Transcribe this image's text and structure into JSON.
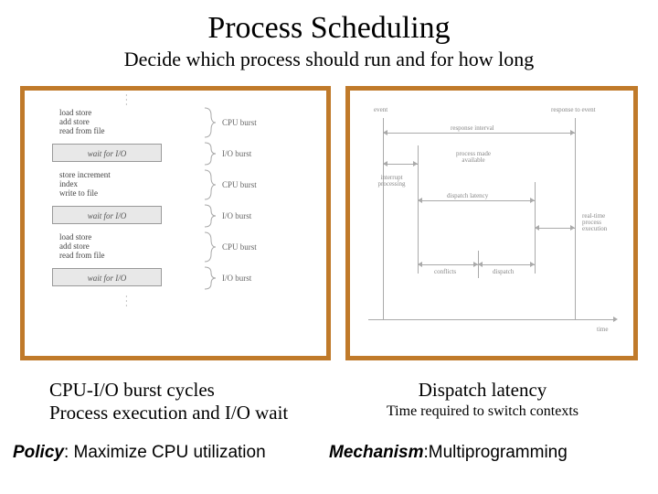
{
  "title": "Process Scheduling",
  "subtitle": "Decide which process should run and for how long",
  "left_panel": {
    "code_blocks": [
      [
        "load store",
        "add store",
        "read from file"
      ],
      [
        "store increment",
        "index",
        "write to file"
      ],
      [
        "load store",
        "add store",
        "read from file"
      ]
    ],
    "io_box_label": "wait for I/O",
    "burst_labels": {
      "cpu": "CPU burst",
      "io": "I/O burst"
    }
  },
  "right_panel": {
    "event": "event",
    "response": "response to event",
    "interval": "response interval",
    "interrupt": "interrupt\nprocessing",
    "available": "process made\navailable",
    "dispatch_latency": "dispatch latency",
    "conflicts": "conflicts",
    "dispatch": "dispatch",
    "realtime": "real-time\nprocess\nexecution",
    "time": "time"
  },
  "captions": {
    "left_line1": "CPU-I/O burst cycles",
    "left_line2": "Process execution and I/O wait",
    "right_title": "Dispatch latency",
    "right_sub": "Time required to switch contexts"
  },
  "bottom": {
    "policy_label": "Policy",
    "policy_text": ": Maximize CPU utilization",
    "mechanism_label": "Mechanism",
    "mechanism_text": ":Multiprogramming"
  }
}
